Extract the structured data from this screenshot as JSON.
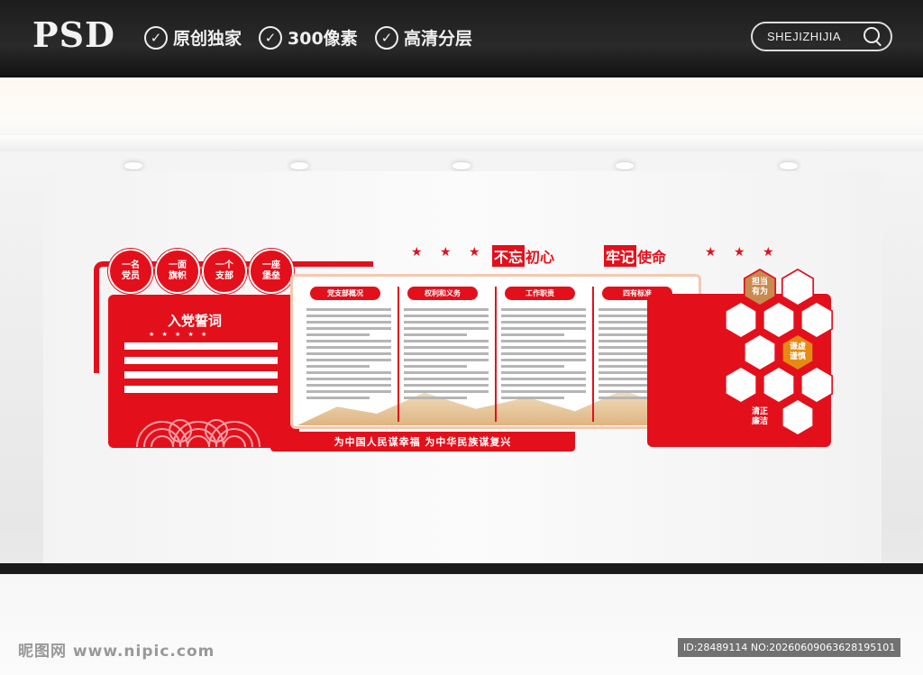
{
  "header": {
    "logo": "PSD",
    "features": [
      {
        "label": "原创独家"
      },
      {
        "label": "300像素"
      },
      {
        "label": "高清分层"
      }
    ],
    "site_search": "SHEJIZHIJIA"
  },
  "wall": {
    "left_panel": {
      "title": "入党誓词",
      "stars": "★ ★ ★ ★ ★",
      "badges": [
        {
          "line1": "一名",
          "line2": "党员"
        },
        {
          "line1": "一面",
          "line2": "旗帜"
        },
        {
          "line1": "一个",
          "line2": "支部"
        },
        {
          "line1": "一座",
          "line2": "堡垒"
        }
      ],
      "bottom_slogan": "为中国人民谋幸福  为中华民族谋复兴"
    },
    "headline": {
      "part1_boxed": "不忘",
      "part1_rest": "初心",
      "part2_boxed": "牢记",
      "part2_rest": "使命"
    },
    "columns": [
      {
        "heading": "党支部概况"
      },
      {
        "heading": "权利和义务"
      },
      {
        "heading": "工作职责"
      },
      {
        "heading": "四有标准"
      }
    ],
    "hexagons": [
      {
        "label": "担当有为",
        "color": "#c98a4f"
      },
      {
        "label": "谦虚谨慎",
        "color": "#e58a14"
      },
      {
        "label": "清正廉洁",
        "color": "#e3101c"
      }
    ]
  },
  "watermark": {
    "left": "昵图网 www.nipic.com",
    "right": "ID:28489114 NO:20260609063628195101"
  },
  "colors": {
    "accent": "#e3101c",
    "gold": "#c98a4f",
    "orange": "#e58a14"
  }
}
